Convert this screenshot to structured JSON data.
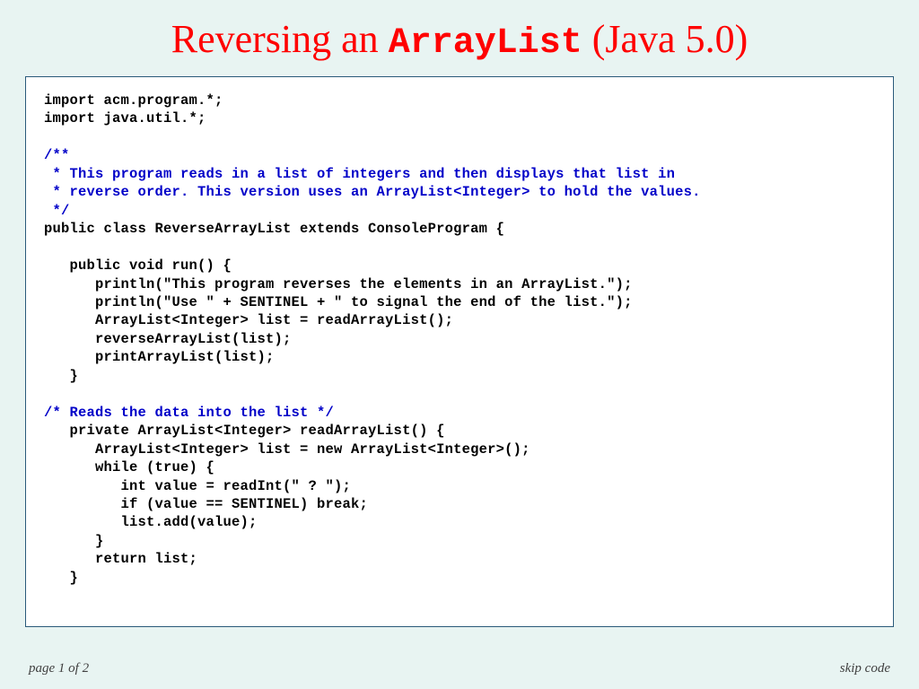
{
  "title": {
    "prefix": "Reversing an ",
    "mono": "ArrayList",
    "suffix": " (Java 5.0)"
  },
  "code": {
    "l1": "import acm.program.*;",
    "l2": "import java.util.*;",
    "c1": "/**",
    "c2": " * This program reads in a list of integers and then displays that list in",
    "c3": " * reverse order. This version uses an ArrayList<Integer> to hold the values.",
    "c4": " */",
    "l3": "public class ReverseArrayList extends ConsoleProgram {",
    "l4": "   public void run() {",
    "l5": "      println(\"This program reverses the elements in an ArrayList.\");",
    "l6": "      println(\"Use \" + SENTINEL + \" to signal the end of the list.\");",
    "l7": "      ArrayList<Integer> list = readArrayList();",
    "l8": "      reverseArrayList(list);",
    "l9": "      printArrayList(list);",
    "l10": "   }",
    "c5": "/* Reads the data into the list */",
    "l11": "   private ArrayList<Integer> readArrayList() {",
    "l12": "      ArrayList<Integer> list = new ArrayList<Integer>();",
    "l13": "      while (true) {",
    "l14": "         int value = readInt(\" ? \");",
    "l15": "         if (value == SENTINEL) break;",
    "l16": "         list.add(value);",
    "l17": "      }",
    "l18": "      return list;",
    "l19": "   }"
  },
  "footer": {
    "left": "page 1 of 2",
    "right": "skip code"
  }
}
